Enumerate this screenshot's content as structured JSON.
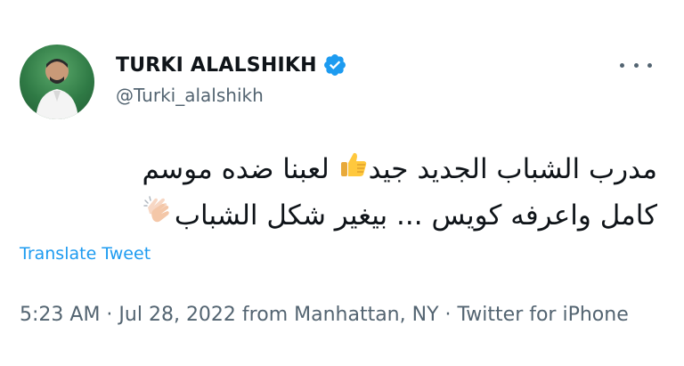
{
  "user": {
    "display_name": "TURKI ALALSHIKH",
    "handle": "@Turki_alalshikh",
    "verified_icon": "verified-badge-icon",
    "accent": "#1d9bf0"
  },
  "tweet": {
    "line1_before_emoji": "مدرب الشباب الجديد جيد",
    "line1_emoji": "thumbs-up-icon",
    "line1_after_emoji": " لعبنا ضده موسم",
    "line2_text": "كامل واعرفه كويس ... بيغير شكل الشباب",
    "line2_emoji": "clapping-hands-icon"
  },
  "translate_label": "Translate Tweet",
  "meta": {
    "time": "5:23 AM",
    "sep1": " · ",
    "date": "Jul 28, 2022",
    "location": " from Manhattan, NY",
    "sep2": " · ",
    "source": "Twitter for iPhone"
  },
  "more_icon": "more-options-icon"
}
